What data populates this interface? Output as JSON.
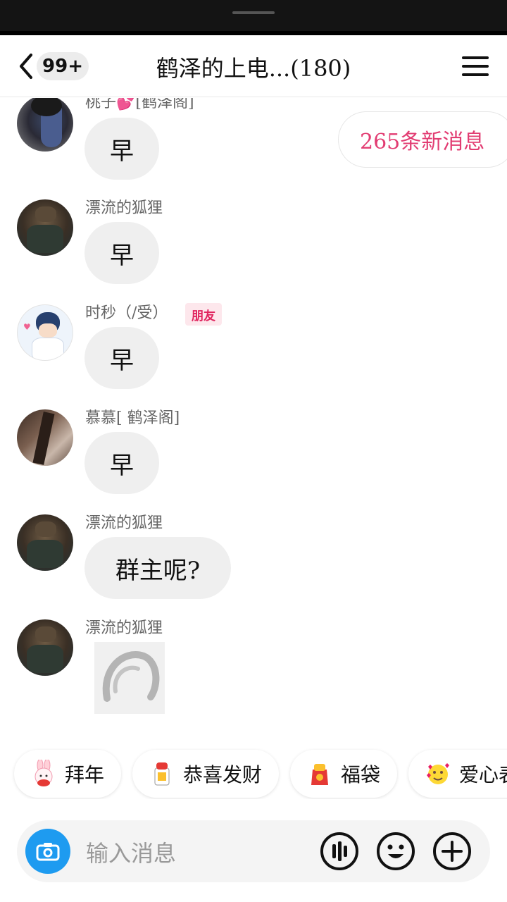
{
  "header": {
    "unread_badge": "99+",
    "title": "鹤泽的上电...(180)"
  },
  "new_messages_pill": "265条新消息",
  "messages": [
    {
      "sender": "桃子💕[鹤泽阁]",
      "text": "早",
      "type": "text"
    },
    {
      "sender": "漂流的狐狸",
      "text": "早",
      "type": "text"
    },
    {
      "sender": "时秒（/受）",
      "tag": "朋友",
      "text": "早",
      "type": "text"
    },
    {
      "sender": "慕慕[ 鹤泽阁]",
      "text": "早",
      "type": "text"
    },
    {
      "sender": "漂流的狐狸",
      "text": "群主呢?",
      "type": "text"
    },
    {
      "sender": "漂流的狐狸",
      "text": "",
      "type": "image"
    }
  ],
  "quick_replies": [
    {
      "label": "拜年",
      "icon": "bunny-icon"
    },
    {
      "label": "恭喜发财",
      "icon": "fortune-icon"
    },
    {
      "label": "福袋",
      "icon": "lucky-bag-icon"
    },
    {
      "label": "爱心表情",
      "icon": "heart-face-icon"
    }
  ],
  "input": {
    "placeholder": "输入消息"
  },
  "colors": {
    "accent_pink": "#e23c72",
    "camera_blue": "#1e9bf0",
    "bubble_gray": "#efefef"
  }
}
